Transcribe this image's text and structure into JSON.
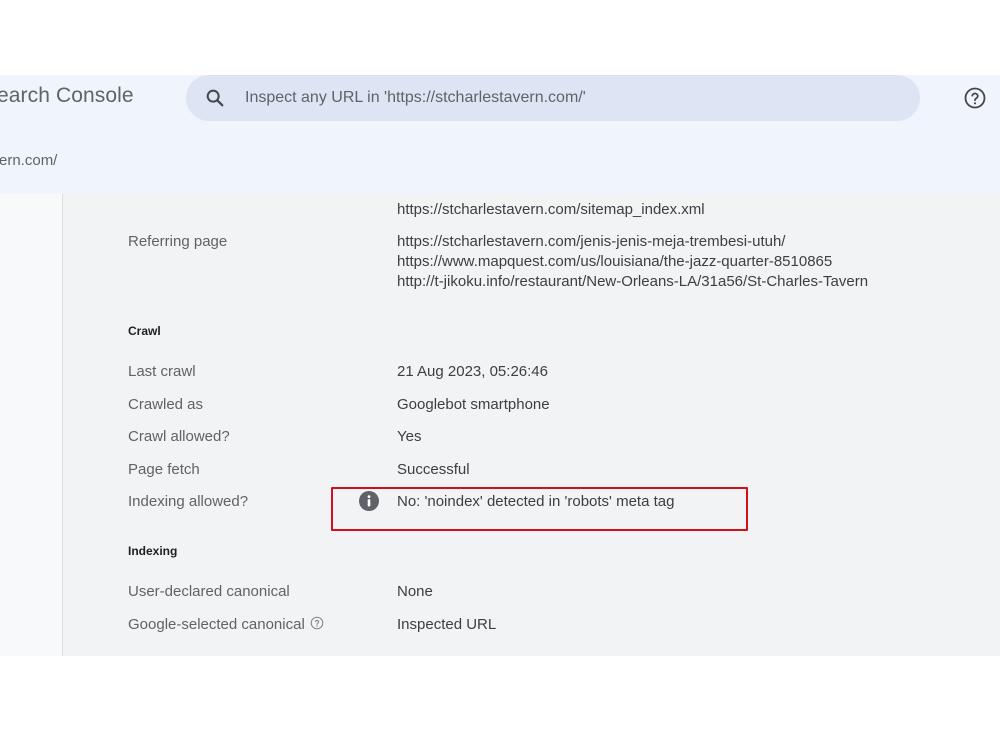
{
  "header": {
    "brand": "earch Console",
    "search_placeholder": "Inspect any URL in 'https://stcharlestavern.com/'",
    "property": "ern.com/"
  },
  "discovery": {
    "sitemaps_partial": "https://stcharlestavern.com/sitemap_index.xml",
    "referring_label": "Referring page",
    "referring_pages": [
      "https://stcharlestavern.com/jenis-jenis-meja-trembesi-utuh/",
      "https://www.mapquest.com/us/louisiana/the-jazz-quarter-8510865",
      "http://t-jikoku.info/restaurant/New-Orleans-LA/31a56/St-Charles-Tavern"
    ]
  },
  "crawl": {
    "title": "Crawl",
    "rows": [
      {
        "label": "Last crawl",
        "value": "21 Aug 2023, 05:26:46"
      },
      {
        "label": "Crawled as",
        "value": "Googlebot smartphone"
      },
      {
        "label": "Crawl allowed?",
        "value": "Yes"
      },
      {
        "label": "Page fetch",
        "value": "Successful"
      },
      {
        "label": "Indexing allowed?",
        "value": "No: 'noindex' detected in 'robots' meta tag"
      }
    ]
  },
  "indexing": {
    "title": "Indexing",
    "rows": [
      {
        "label": "User-declared canonical",
        "value": "None"
      },
      {
        "label": "Google-selected canonical",
        "value": "Inspected URL"
      }
    ]
  },
  "colors": {
    "highlight": "#d0101a",
    "header_bg": "#f0f4fc",
    "search_bg": "#dde5f4"
  },
  "icons": [
    "search-icon",
    "help-icon",
    "info-icon",
    "question-circle-icon"
  ]
}
